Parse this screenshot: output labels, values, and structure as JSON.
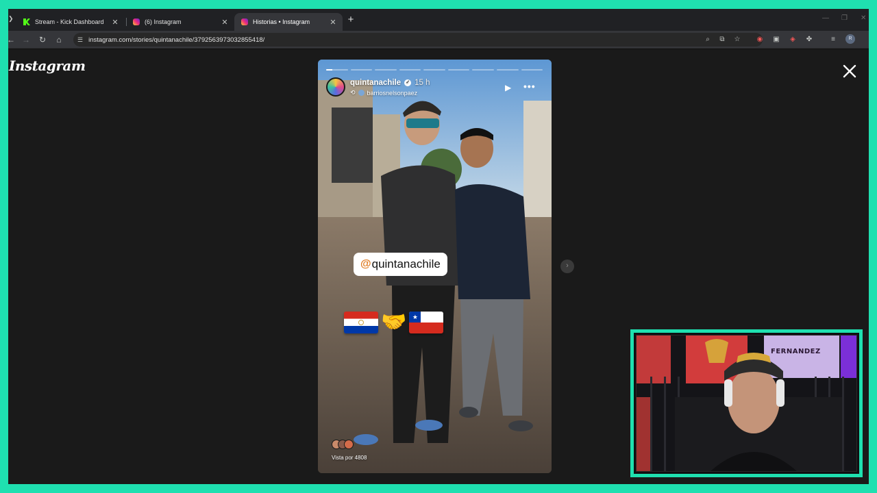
{
  "browser": {
    "tabs": [
      {
        "label": "Stream - Kick Dashboard",
        "icon": "kick-icon",
        "active": false
      },
      {
        "label": "(6) Instagram",
        "icon": "instagram-icon",
        "active": false
      },
      {
        "label": "Historias • Instagram",
        "icon": "instagram-icon",
        "active": true
      }
    ],
    "tab_close_glyph": "✕",
    "new_tab_glyph": "+",
    "url": "instagram.com/stories/quintanachile/3792563973032855418/",
    "profile_initial": "R",
    "colors": {
      "tabstrip": "#202124",
      "toolbar": "#35363a",
      "omnibox": "#282828"
    }
  },
  "instagram": {
    "logo": "Instagram",
    "story": {
      "username": "quintanachile",
      "time_ago": "15 h",
      "reposted_from": "barriosnelsonpaez",
      "mention": "quintanachile",
      "mention_prefix": "@",
      "views_label": "Vista por 4808",
      "progress": {
        "segments": 9,
        "current_index": 0,
        "current_fraction": 0.3
      }
    },
    "icons": {
      "close": "close-icon",
      "next": "chevron-right-icon",
      "play": "play-icon",
      "more": "more-options-icon",
      "verified": "verified-badge-icon"
    }
  },
  "webcam": {
    "poster_text": "FERNANDEZ",
    "border_color": "#1fe0b0"
  }
}
